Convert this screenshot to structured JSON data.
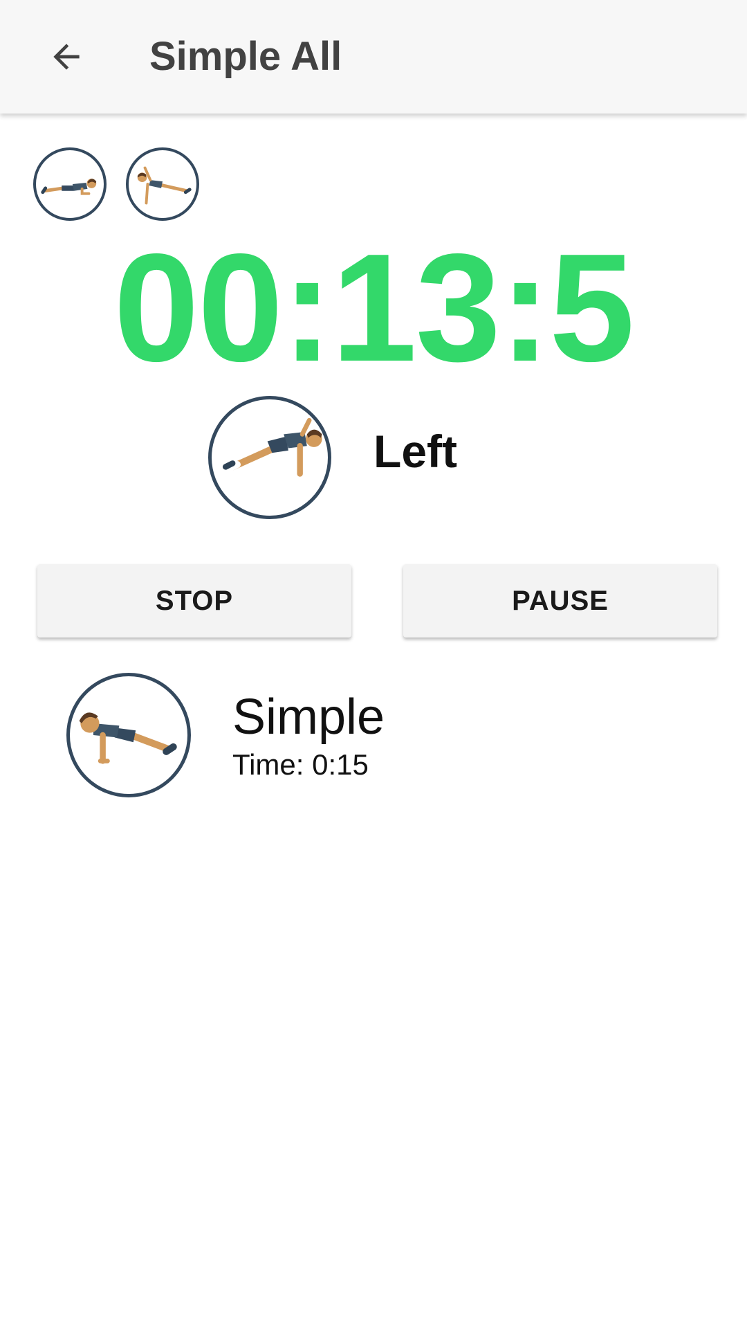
{
  "app_bar": {
    "title": "Simple All",
    "back_icon": "arrow-back-icon"
  },
  "exercise_queue": [
    {
      "name": "plank",
      "icon": "plank-figure-icon"
    },
    {
      "name": "side-plank",
      "icon": "side-plank-figure-icon"
    }
  ],
  "timer": {
    "value": "00:13:5",
    "color": "#33d86a"
  },
  "current_exercise": {
    "label": "Left",
    "icon": "side-plank-figure-icon"
  },
  "controls": {
    "stop_label": "STOP",
    "pause_label": "PAUSE"
  },
  "workout_list": [
    {
      "title": "Simple",
      "time": "Time: 0:15",
      "icon": "push-up-figure-icon"
    }
  ],
  "colors": {
    "circle_border": "#34495e",
    "app_bar_bg": "#f7f7f7",
    "button_bg": "#f3f3f3"
  }
}
